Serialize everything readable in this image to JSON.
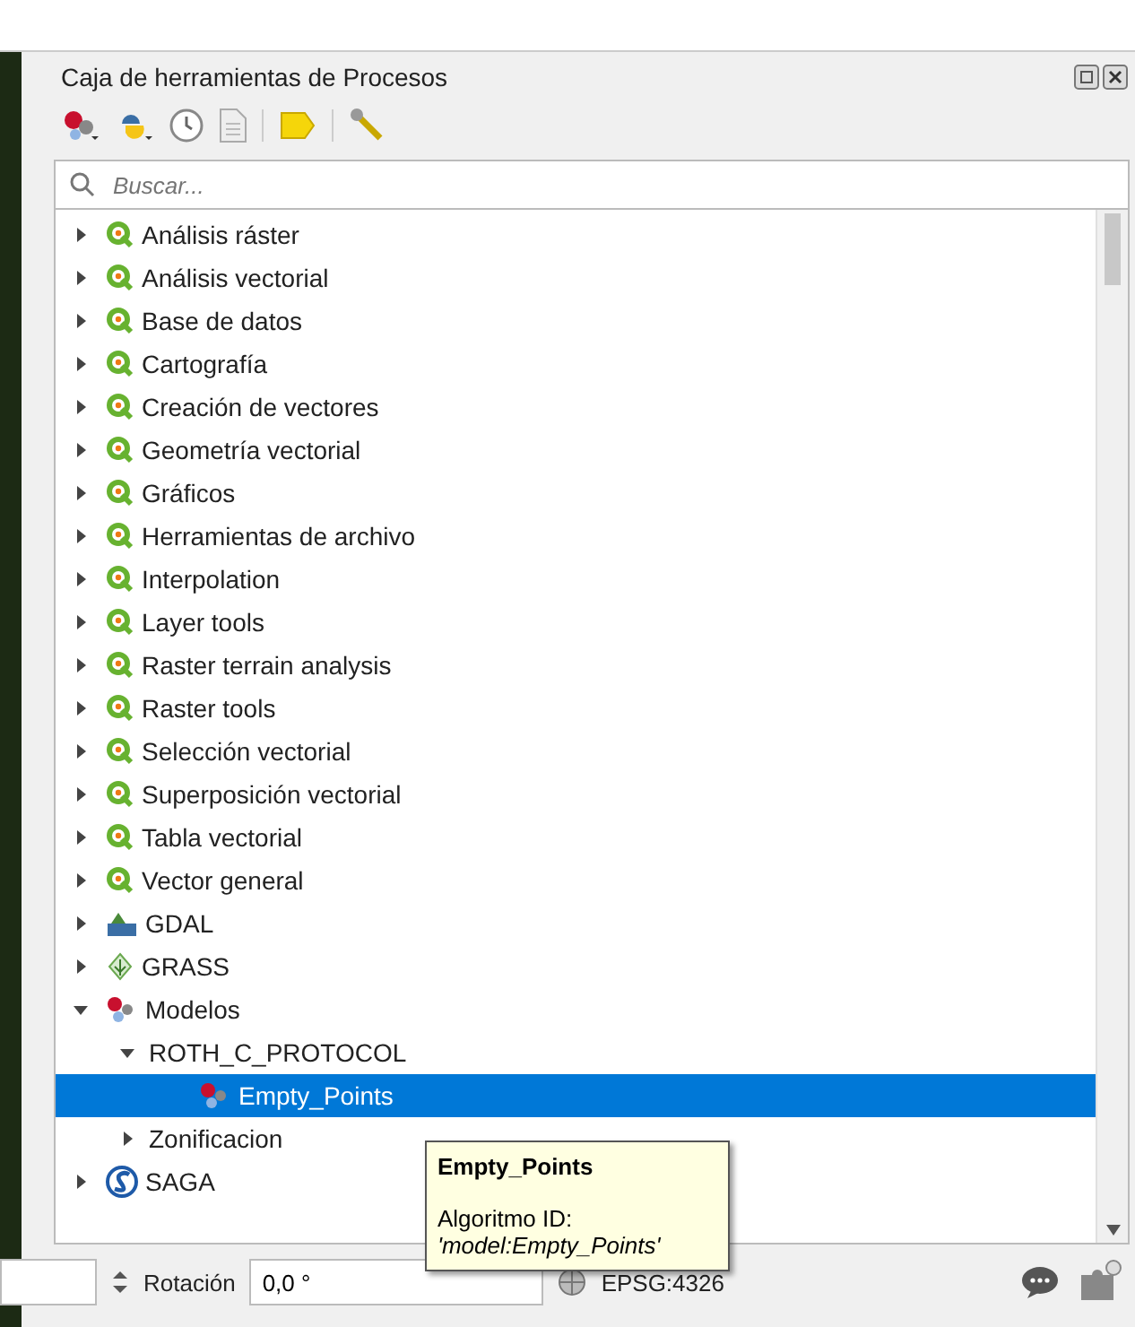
{
  "panel": {
    "title": "Caja de herramientas de Procesos",
    "search": {
      "placeholder": "Buscar..."
    }
  },
  "tree": [
    {
      "label": "Análisis ráster",
      "kind": "qgis",
      "expanded": false,
      "selected": false
    },
    {
      "label": "Análisis vectorial",
      "kind": "qgis",
      "expanded": false,
      "selected": false
    },
    {
      "label": "Base de datos",
      "kind": "qgis",
      "expanded": false,
      "selected": false
    },
    {
      "label": "Cartografía",
      "kind": "qgis",
      "expanded": false,
      "selected": false
    },
    {
      "label": "Creación de vectores",
      "kind": "qgis",
      "expanded": false,
      "selected": false
    },
    {
      "label": "Geometría vectorial",
      "kind": "qgis",
      "expanded": false,
      "selected": false
    },
    {
      "label": "Gráficos",
      "kind": "qgis",
      "expanded": false,
      "selected": false
    },
    {
      "label": "Herramientas de archivo",
      "kind": "qgis",
      "expanded": false,
      "selected": false
    },
    {
      "label": "Interpolation",
      "kind": "qgis",
      "expanded": false,
      "selected": false
    },
    {
      "label": "Layer tools",
      "kind": "qgis",
      "expanded": false,
      "selected": false
    },
    {
      "label": "Raster terrain analysis",
      "kind": "qgis",
      "expanded": false,
      "selected": false
    },
    {
      "label": "Raster tools",
      "kind": "qgis",
      "expanded": false,
      "selected": false
    },
    {
      "label": "Selección vectorial",
      "kind": "qgis",
      "expanded": false,
      "selected": false
    },
    {
      "label": "Superposición vectorial",
      "kind": "qgis",
      "expanded": false,
      "selected": false
    },
    {
      "label": "Tabla vectorial",
      "kind": "qgis",
      "expanded": false,
      "selected": false
    },
    {
      "label": "Vector general",
      "kind": "qgis",
      "expanded": false,
      "selected": false
    },
    {
      "label": "GDAL",
      "kind": "gdal",
      "expanded": false,
      "selected": false
    },
    {
      "label": "GRASS",
      "kind": "grass",
      "expanded": false,
      "selected": false
    },
    {
      "label": "Modelos",
      "kind": "models",
      "expanded": true,
      "selected": false,
      "children": [
        {
          "label": "ROTH_C_PROTOCOL",
          "kind": "group",
          "expanded": true,
          "selected": false,
          "children": [
            {
              "label": "Empty_Points",
              "kind": "model",
              "selected": true
            }
          ]
        },
        {
          "label": "Zonificacion",
          "kind": "group",
          "expanded": false,
          "selected": false
        }
      ]
    },
    {
      "label": "SAGA",
      "kind": "saga",
      "expanded": false,
      "selected": false
    }
  ],
  "tooltip": {
    "title": "Empty_Points",
    "label": "Algoritmo ID:",
    "value": "'model:Empty_Points'"
  },
  "status_bar": {
    "rotation_label": "Rotación",
    "rotation_value": "0,0 °",
    "crs": "EPSG:4326"
  }
}
